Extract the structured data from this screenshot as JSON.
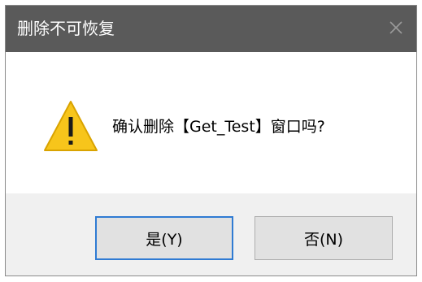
{
  "dialog": {
    "title": "删除不可恢复",
    "close_icon": "close-icon",
    "message": "确认删除【Get_Test】窗口吗?",
    "warning_icon": "warning-icon",
    "buttons": {
      "yes_label": "是(Y)",
      "no_label": "否(N)"
    }
  },
  "colors": {
    "titlebar": "#5a5a5a",
    "title_text": "#ffffff",
    "footer": "#f0f0f0",
    "button_bg": "#e1e1e1",
    "primary_border": "#2f7bd3",
    "warning_fill": "#f7c51b"
  }
}
